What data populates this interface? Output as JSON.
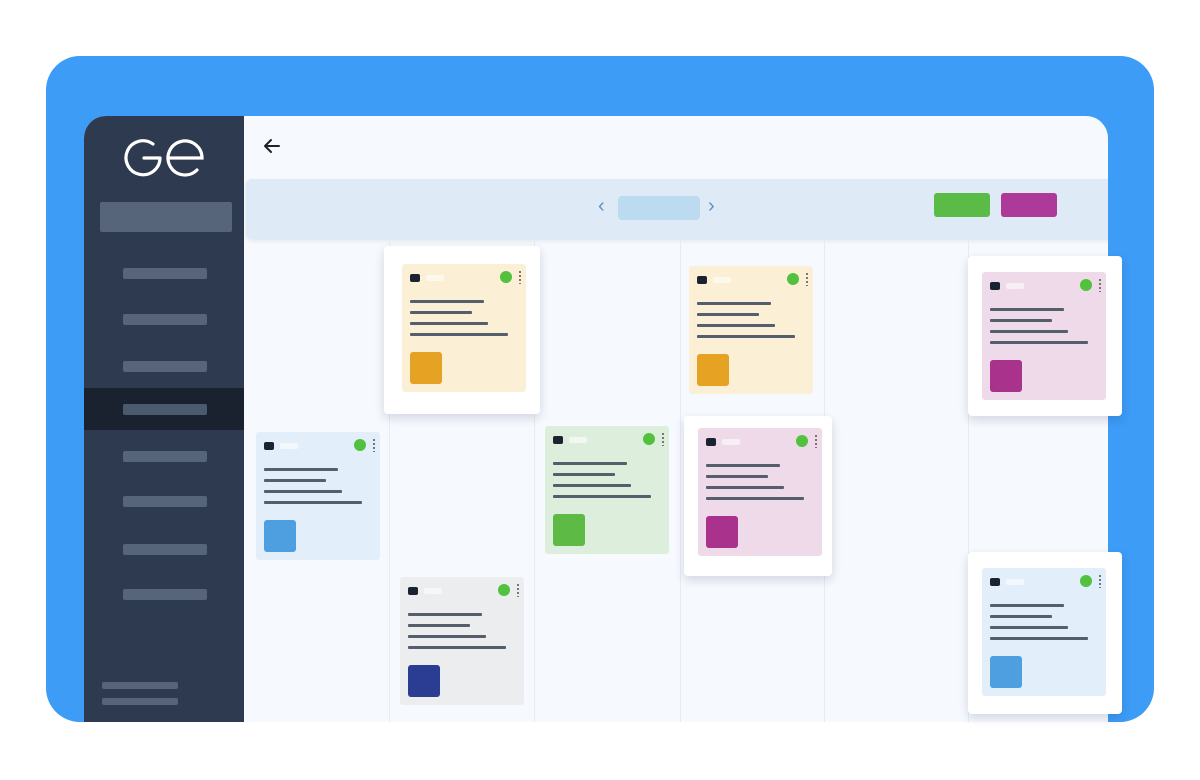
{
  "app": {
    "logo_text": "Ge",
    "icons": {
      "back": "arrow-left-icon",
      "prev": "chevron-left-icon",
      "next": "chevron-right-icon",
      "status": "status-dot-icon",
      "menu": "kebab-menu-icon"
    }
  },
  "toolbar": {
    "prev_label": "‹",
    "next_label": "›"
  },
  "colors": {
    "frame": "#3d9cf6",
    "sidebar": "#2d3a4f",
    "sidebar_active": "#1a222f",
    "green": "#5abb46",
    "magenta": "#ad3a98",
    "status_online": "#52c13e",
    "card_yellow": "#fbefd6",
    "card_pink": "#efdaea",
    "card_blue": "#e2effb",
    "card_green": "#ddefdc",
    "card_gray": "#ebedef",
    "sq_orange": "#e6a223",
    "sq_magenta": "#a9328d",
    "sq_blue": "#4e9fdf",
    "sq_green": "#5cba45",
    "sq_navy": "#2a3d92"
  },
  "sidebar": {
    "nav_count": 8,
    "active_index": 3
  },
  "cards": [
    {
      "bg": "#fbefd6",
      "square": "#e6a223"
    },
    {
      "bg": "#fbefd6",
      "square": "#e6a223"
    },
    {
      "bg": "#efdaea",
      "square": "#a9328d"
    },
    {
      "bg": "#e2effb",
      "square": "#4e9fdf"
    },
    {
      "bg": "#ddefdc",
      "square": "#5cba45"
    },
    {
      "bg": "#efdaea",
      "square": "#a9328d"
    },
    {
      "bg": "#ebedef",
      "square": "#2a3d92"
    },
    {
      "bg": "#e2effb",
      "square": "#4e9fdf"
    }
  ]
}
